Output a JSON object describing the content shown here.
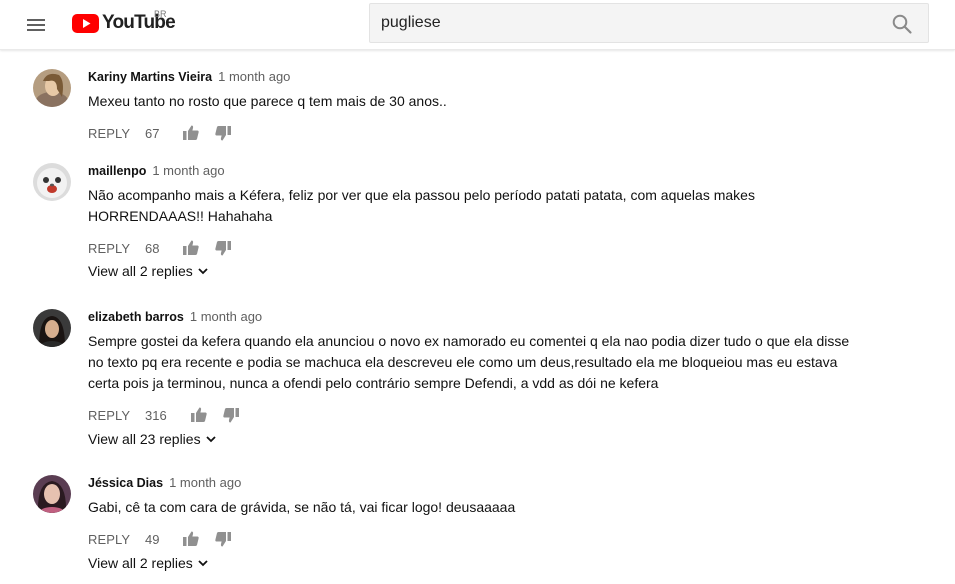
{
  "header": {
    "logo_text": "YouTube",
    "country_code": "BR",
    "search_value": "pugliese"
  },
  "colors": {
    "brand_red": "#ff0000",
    "text_secondary": "#606060"
  },
  "comments": [
    {
      "author": "Kariny Martins Vieira",
      "time": "1 month ago",
      "lines": [
        "Mexeu tanto  no rosto  que parece q tem mais de 30 anos.."
      ],
      "reply_label": "REPLY",
      "likes": "67",
      "view_replies": ""
    },
    {
      "author": "maillenpo",
      "time": "1 month ago",
      "lines": [
        "Não acompanho mais a Kéfera, feliz por ver que ela passou pelo período patati patata, com aquelas makes",
        "HORRENDAAAS!! Hahahaha"
      ],
      "reply_label": "REPLY",
      "likes": "68",
      "view_replies": "View all 2 replies"
    },
    {
      "author": "elizabeth barros",
      "time": "1 month ago",
      "lines": [
        "Sempre gostei da kefera quando ela anunciou o novo ex namorado eu comentei q ela nao podia dizer tudo o que ela disse",
        "no texto pq era recente e podia se machuca ela descreveu ele como um deus,resultado ela me bloqueiou mas eu estava",
        "certa pois ja terminou, nunca a ofendi pelo contrário sempre Defendi, a vdd as dói ne kefera"
      ],
      "reply_label": "REPLY",
      "likes": "316",
      "view_replies": "View all 23 replies"
    },
    {
      "author": "Jéssica Dias",
      "time": "1 month ago",
      "lines": [
        "Gabi, cê ta com cara de grávida, se não tá, vai ficar logo! deusaaaaa"
      ],
      "reply_label": "REPLY",
      "likes": "49",
      "view_replies": "View all 2 replies"
    }
  ]
}
